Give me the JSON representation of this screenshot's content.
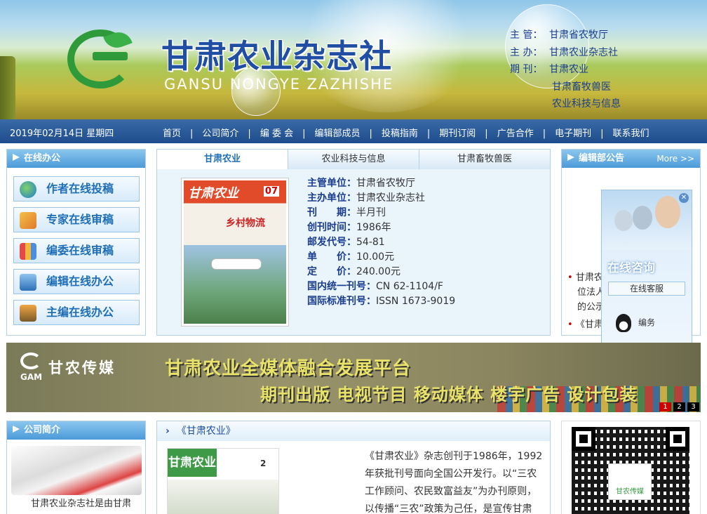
{
  "header": {
    "title_cn": "甘肃农业杂志社",
    "title_en": "GANSU NONGYE ZAZHISHE",
    "info": [
      {
        "label": "主 管：",
        "value": "甘肃省农牧厅"
      },
      {
        "label": "主 办：",
        "value": "甘肃农业杂志社"
      },
      {
        "label": "期 刊：",
        "value": "甘肃农业"
      }
    ],
    "info_extra": [
      "甘肃畜牧兽医",
      "农业科技与信息"
    ]
  },
  "nav": {
    "date": "2019年02月14日 星期四",
    "items": [
      "首页",
      "公司简介",
      "编 委 会",
      "编辑部成员",
      "投稿指南",
      "期刊订阅",
      "广告合作",
      "电子期刊",
      "联系我们"
    ],
    "separator": "|"
  },
  "left_panel": {
    "title": "在线办公",
    "buttons": [
      {
        "label": "作者在线投稿",
        "icon": "globe-icon"
      },
      {
        "label": "专家在线审稿",
        "icon": "expert-icon"
      },
      {
        "label": "编委在线审稿",
        "icon": "books-icon"
      },
      {
        "label": "编辑在线办公",
        "icon": "computer-icon"
      },
      {
        "label": "主编在线办公",
        "icon": "server-icon"
      }
    ]
  },
  "center_panel": {
    "tabs": [
      "甘肃农业",
      "农业科技与信息",
      "甘肃畜牧兽医"
    ],
    "active_tab": 0,
    "cover": {
      "title": "甘肃农业",
      "issue": "07",
      "headline": "乡村物流"
    },
    "meta": [
      {
        "label": "主管单位：",
        "value": "甘肃省农牧厅"
      },
      {
        "label": "主办单位：",
        "value": "甘肃农业杂志社"
      },
      {
        "label": "刊　　期：",
        "value": "半月刊"
      },
      {
        "label": "创刊时间：",
        "value": "1986年"
      },
      {
        "label": "邮发代号：",
        "value": "54-81"
      },
      {
        "label": "单　　价：",
        "value": "10.00元"
      },
      {
        "label": "定　　价：",
        "value": "240.00元"
      },
      {
        "label": "国内统一刊号：",
        "value": "CN 62-1104/F"
      },
      {
        "label": "国际标准刊号：",
        "value": "ISSN 1673-9019"
      }
    ]
  },
  "right_panel": {
    "title": "编辑部公告",
    "more": "More >>",
    "notices": [
      "甘肃农",
      "位法人",
      "的公示",
      "《甘肃"
    ]
  },
  "consult": {
    "close": "✕",
    "title": "在线咨询",
    "service_button": "在线客服",
    "qq_label": "编务"
  },
  "banner": {
    "brand_short": "GAM",
    "brand_cn": "甘农传媒",
    "line1": "甘肃农业全媒体融合发展平台",
    "line2": "期刊出版 电视节目 移动媒体 楼宇广告 设计包装",
    "pages": [
      "1",
      "2",
      "3"
    ],
    "active_page": 0
  },
  "company": {
    "title": "公司简介",
    "text": "甘肃农业杂志社是由甘肃"
  },
  "magazine": {
    "title": "《甘肃农业》",
    "cover_title": "甘肃农业",
    "cover_issue": "2",
    "body": "《甘肃农业》杂志创刊于1986年，1992年获批刊号面向全国公开发行。以“三农工作顾问、农民致富益友”为办刊原则，以传播“三农”政策为己任，是宣传甘肃"
  },
  "qr": {
    "label": "甘农传媒"
  },
  "colors": {
    "accent_blue": "#1f4ea3",
    "nav_bar": "#1e4c8c",
    "panel_header": "#4b9ad8",
    "logo_green": "#2e9a3a",
    "banner_text": "#e9e36a"
  }
}
